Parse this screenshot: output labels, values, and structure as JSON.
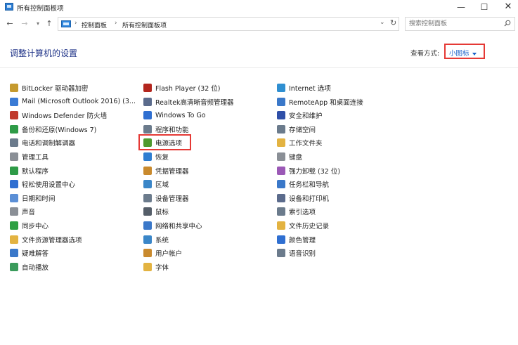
{
  "window": {
    "title": "所有控制面板项",
    "minimize_glyph": "—",
    "maximize_glyph": "☐",
    "close_glyph": "✕"
  },
  "address": {
    "back_glyph": "←",
    "forward_glyph": "→",
    "recent_glyph": "▾",
    "up_glyph": "↑",
    "breadcrumb": [
      "控制面板",
      "所有控制面板项"
    ],
    "sep_glyph": "›",
    "dropdown_glyph": "⌄",
    "refresh_glyph": "↻",
    "search_placeholder": "搜索控制面板"
  },
  "header": {
    "title": "调整计算机的设置",
    "view_by_label": "查看方式:",
    "view_by_value": "小图标"
  },
  "items": {
    "col1": [
      {
        "label": "BitLocker 驱动器加密",
        "icon": "bitlocker-icon",
        "color": "#c59a2e"
      },
      {
        "label": "Mail (Microsoft Outlook 2016) (3...",
        "icon": "mail-icon",
        "color": "#3a7bd5"
      },
      {
        "label": "Windows Defender 防火墙",
        "icon": "firewall-icon",
        "color": "#c0392b"
      },
      {
        "label": "备份和还原(Windows 7)",
        "icon": "backup-icon",
        "color": "#2e9b47"
      },
      {
        "label": "电话和调制解调器",
        "icon": "phone-modem-icon",
        "color": "#6b7b8c"
      },
      {
        "label": "管理工具",
        "icon": "admin-tools-icon",
        "color": "#8a8f96"
      },
      {
        "label": "默认程序",
        "icon": "default-programs-icon",
        "color": "#2e9b47"
      },
      {
        "label": "轻松使用设置中心",
        "icon": "ease-of-access-icon",
        "color": "#2f6fd1"
      },
      {
        "label": "日期和时间",
        "icon": "date-time-icon",
        "color": "#5b8fd6"
      },
      {
        "label": "声音",
        "icon": "sound-icon",
        "color": "#8a8f96"
      },
      {
        "label": "同步中心",
        "icon": "sync-center-icon",
        "color": "#2ea043"
      },
      {
        "label": "文件资源管理器选项",
        "icon": "folder-options-icon",
        "color": "#e3b341"
      },
      {
        "label": "疑难解答",
        "icon": "troubleshooting-icon",
        "color": "#3a78c9"
      },
      {
        "label": "自动播放",
        "icon": "autoplay-icon",
        "color": "#3a9b5b"
      }
    ],
    "col2": [
      {
        "label": "Flash Player (32 位)",
        "icon": "flash-player-icon",
        "color": "#b3261e"
      },
      {
        "label": "Realtek高清晰音频管理器",
        "icon": "realtek-audio-icon",
        "color": "#5b6b8c"
      },
      {
        "label": "Windows To Go",
        "icon": "windows-to-go-icon",
        "color": "#2f6fd1"
      },
      {
        "label": "程序和功能",
        "icon": "programs-features-icon",
        "color": "#6b7b8c"
      },
      {
        "label": "电源选项",
        "icon": "power-options-icon",
        "color": "#4e9a2e"
      },
      {
        "label": "恢复",
        "icon": "recovery-icon",
        "color": "#2e7dd1"
      },
      {
        "label": "凭据管理器",
        "icon": "credential-manager-icon",
        "color": "#c98a2e"
      },
      {
        "label": "区域",
        "icon": "region-icon",
        "color": "#3a86c8"
      },
      {
        "label": "设备管理器",
        "icon": "device-manager-icon",
        "color": "#6b7b8c"
      },
      {
        "label": "鼠标",
        "icon": "mouse-icon",
        "color": "#555e69"
      },
      {
        "label": "网络和共享中心",
        "icon": "network-sharing-icon",
        "color": "#3a78c9"
      },
      {
        "label": "系统",
        "icon": "system-icon",
        "color": "#3a86c8"
      },
      {
        "label": "用户帐户",
        "icon": "user-accounts-icon",
        "color": "#c98a2e"
      },
      {
        "label": "字体",
        "icon": "fonts-icon",
        "color": "#e3b341"
      }
    ],
    "col3": [
      {
        "label": "Internet 选项",
        "icon": "internet-options-icon",
        "color": "#2f8fd1"
      },
      {
        "label": "RemoteApp 和桌面连接",
        "icon": "remoteapp-icon",
        "color": "#3a78c9"
      },
      {
        "label": "安全和维护",
        "icon": "security-maintenance-icon",
        "color": "#2f4fa8"
      },
      {
        "label": "存储空间",
        "icon": "storage-spaces-icon",
        "color": "#6b7b8c"
      },
      {
        "label": "工作文件夹",
        "icon": "work-folders-icon",
        "color": "#e3b341"
      },
      {
        "label": "键盘",
        "icon": "keyboard-icon",
        "color": "#8a8f96"
      },
      {
        "label": "强力卸载 (32 位)",
        "icon": "uninstaller-icon",
        "color": "#9b59b6"
      },
      {
        "label": "任务栏和导航",
        "icon": "taskbar-navigation-icon",
        "color": "#3a78c9"
      },
      {
        "label": "设备和打印机",
        "icon": "devices-printers-icon",
        "color": "#5b6b8c"
      },
      {
        "label": "索引选项",
        "icon": "indexing-options-icon",
        "color": "#6b7b8c"
      },
      {
        "label": "文件历史记录",
        "icon": "file-history-icon",
        "color": "#e3b341"
      },
      {
        "label": "颜色管理",
        "icon": "color-management-icon",
        "color": "#2f6fd1"
      },
      {
        "label": "语音识别",
        "icon": "speech-recognition-icon",
        "color": "#6b7b8c"
      }
    ]
  }
}
